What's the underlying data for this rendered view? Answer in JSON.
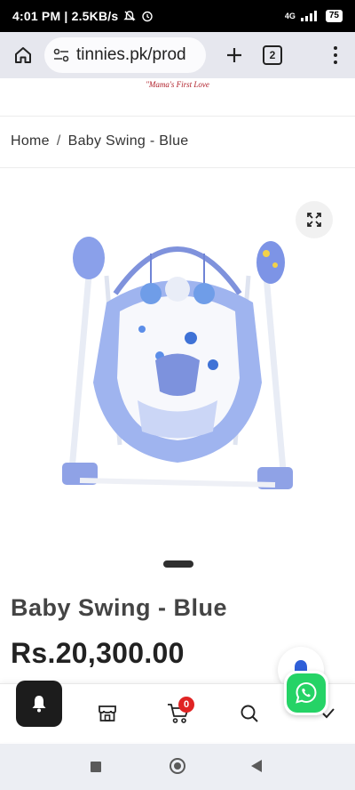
{
  "status_bar": {
    "time_text": "4:01 PM | 2.5KB/s",
    "network": "4G",
    "battery": "75",
    "icons": [
      "mute-icon",
      "alarm-icon",
      "signal-icon",
      "battery-icon"
    ]
  },
  "browser": {
    "url": "tinnies.pk/prod",
    "tab_count": "2",
    "icons": [
      "home-icon",
      "site-settings-icon",
      "plus-icon",
      "tabs-icon",
      "overflow-menu-icon"
    ]
  },
  "site": {
    "tagline": "\"Mama's First Love"
  },
  "breadcrumb": {
    "home": "Home",
    "separator": "/",
    "current": "Baby Swing - Blue"
  },
  "product": {
    "title": "Baby Swing - Blue",
    "price": "Rs.20,300.00",
    "image_alt": "Blue baby swing"
  },
  "bottom_nav": {
    "cart_count": "0",
    "icons": [
      "notification-bell-icon",
      "store-icon",
      "cart-icon",
      "search-icon",
      "checkmark-icon"
    ]
  },
  "colors": {
    "price_text": "#222222",
    "cart_badge": "#e02424",
    "whatsapp": "#25d366",
    "bell_blue": "#2f5fd8",
    "tagline_red": "#b0202a"
  }
}
